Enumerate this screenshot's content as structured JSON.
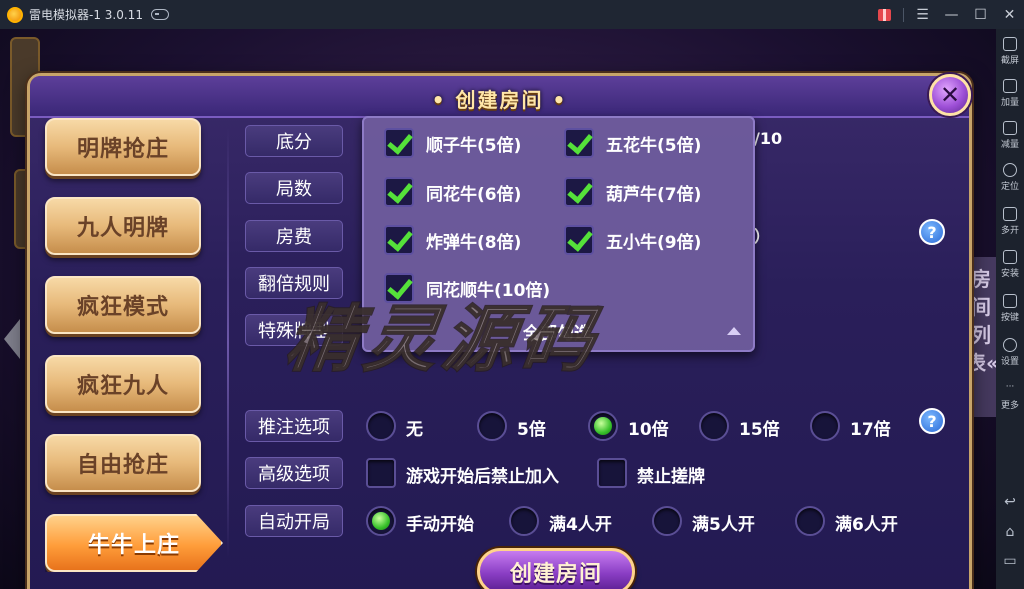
{
  "window": {
    "title": "雷电模拟器-1 3.0.11",
    "controls": [
      "gift-icon",
      "menu-icon",
      "minimize-icon",
      "maximize-icon",
      "close-icon"
    ]
  },
  "toolbar": {
    "screenshot": "截屏",
    "volume_up": "加量",
    "volume_down": "减量",
    "location": "定位",
    "multi_open": "多开",
    "install": "安装",
    "keys": "按键",
    "settings": "设置",
    "more": "更多"
  },
  "background": {
    "room_list_tab": "房间列表«"
  },
  "dialog": {
    "title": "• 创建房间 •",
    "close_label": "✕",
    "tabs": [
      {
        "label": "明牌抢庄",
        "active": false
      },
      {
        "label": "九人明牌",
        "active": false
      },
      {
        "label": "疯狂模式",
        "active": false
      },
      {
        "label": "疯狂九人",
        "active": false
      },
      {
        "label": "自由抢庄",
        "active": false
      },
      {
        "label": "牛牛上庄",
        "active": true
      }
    ],
    "rows": {
      "base_score": "底分",
      "rounds": "局数",
      "room_fee": "房费",
      "double_rule": "翻倍规则",
      "special_hand": "特殊牌型",
      "bet_option": "推注选项",
      "advanced": "高级选项",
      "auto_start": "自动开局"
    },
    "partial_text": {
      "base_score_tail": "/10",
      "room_fee_tail": "）"
    },
    "help_label": "?",
    "special_hands": [
      {
        "label": "顺子牛(5倍)",
        "checked": true
      },
      {
        "label": "五花牛(5倍)",
        "checked": true
      },
      {
        "label": "同花牛(6倍)",
        "checked": true
      },
      {
        "label": "葫芦牛(7倍)",
        "checked": true
      },
      {
        "label": "炸弹牛(8倍)",
        "checked": true
      },
      {
        "label": "五小牛(9倍)",
        "checked": true
      },
      {
        "label": "同花顺牛(10倍)",
        "checked": true
      }
    ],
    "select_all": "全部勾选",
    "bet_options": [
      {
        "label": "无",
        "selected": false
      },
      {
        "label": "5倍",
        "selected": false
      },
      {
        "label": "10倍",
        "selected": true
      },
      {
        "label": "15倍",
        "selected": false
      },
      {
        "label": "17倍",
        "selected": false
      }
    ],
    "advanced_options": [
      {
        "label": "游戏开始后禁止加入",
        "checked": false
      },
      {
        "label": "禁止搓牌",
        "checked": false
      }
    ],
    "auto_start_options": [
      {
        "label": "手动开始",
        "selected": true
      },
      {
        "label": "满4人开",
        "selected": false
      },
      {
        "label": "满5人开",
        "selected": false
      },
      {
        "label": "满6人开",
        "selected": false
      }
    ],
    "create_button": "创建房间"
  },
  "watermark": "精灵源码",
  "colors": {
    "dialog_bg": "#2a1f5a",
    "tab_gold": "#e7b97a",
    "active_tab_orange": "#ff9d3a",
    "radio_selected_green": "#37c02a",
    "checkmark_green": "#55e13a",
    "create_button_purple": "#8a3ec4"
  }
}
